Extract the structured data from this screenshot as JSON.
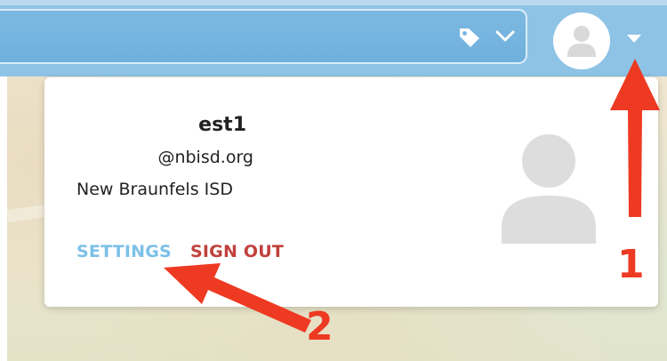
{
  "header": {
    "tag_icon": "tag-icon",
    "filter_icon": "chevron-down-icon",
    "avatar_icon": "user-avatar-icon",
    "menu_icon": "caret-down-icon"
  },
  "dropdown": {
    "name": "est1",
    "email": "@nbisd.org",
    "organization": "New Braunfels ISD",
    "settings_label": "SETTINGS",
    "signout_label": "SIGN OUT",
    "avatar_icon": "user-silhouette-icon"
  },
  "annotations": {
    "step1": "1",
    "step2": "2",
    "color": "#ee3a22"
  },
  "colors": {
    "header_blue": "#8ec3e6",
    "settings_blue": "#7cc1e8",
    "signout_red": "#c0413c"
  }
}
